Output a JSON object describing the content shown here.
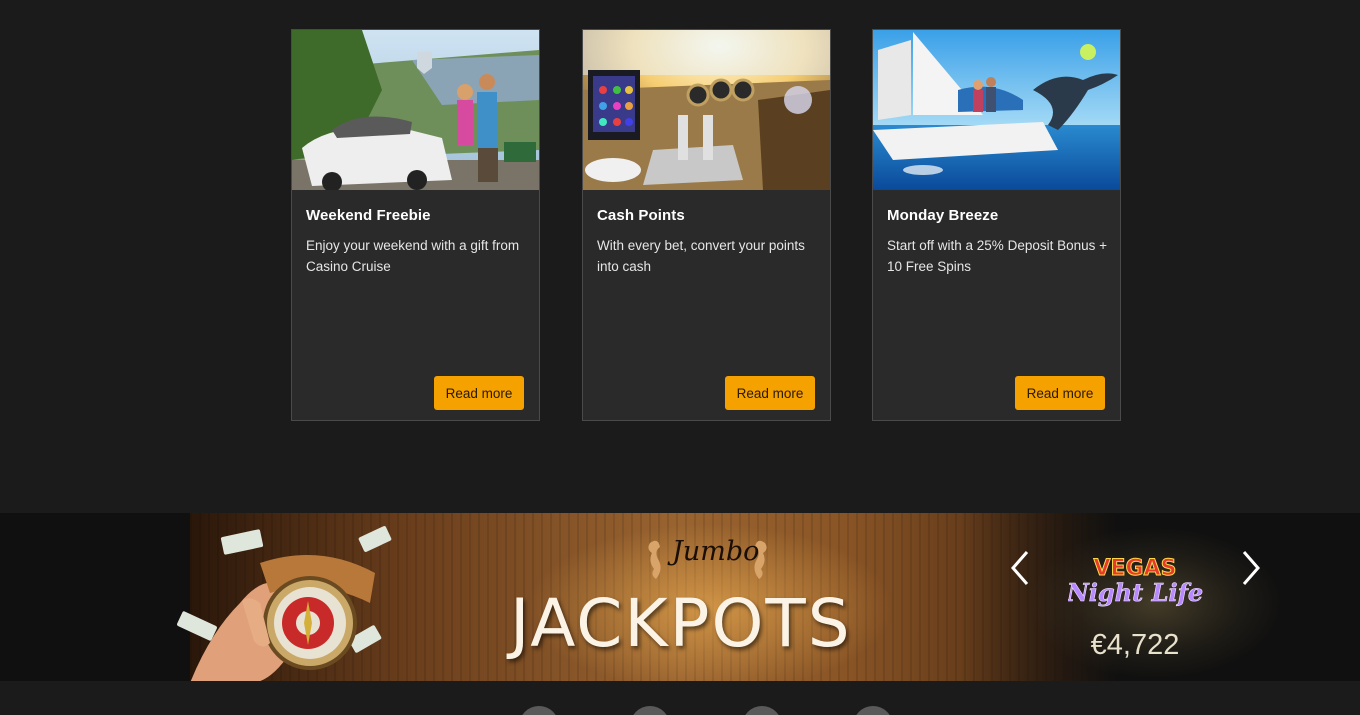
{
  "promotions": [
    {
      "title": "Weekend Freebie",
      "description": "Enjoy your weekend with a gift from Casino Cruise",
      "button": "Read more"
    },
    {
      "title": "Cash Points",
      "description": "With every bet, convert your points into cash",
      "button": "Read more"
    },
    {
      "title": "Monday Breeze",
      "description": "Start off with a 25% Deposit Bonus + 10 Free Spins",
      "button": "Read more"
    }
  ],
  "jackpot_banner": {
    "tagline": "Jumbo",
    "heading": "JACKPOTS",
    "game_logo_text": "VEGAS Night Life",
    "amount": "€4,722",
    "prev_icon": "chevron-left-icon",
    "next_icon": "chevron-right-icon"
  },
  "colors": {
    "page_bg": "#1c1b1c",
    "card_bg": "#2a2a2a",
    "button_bg": "#f5a100"
  }
}
